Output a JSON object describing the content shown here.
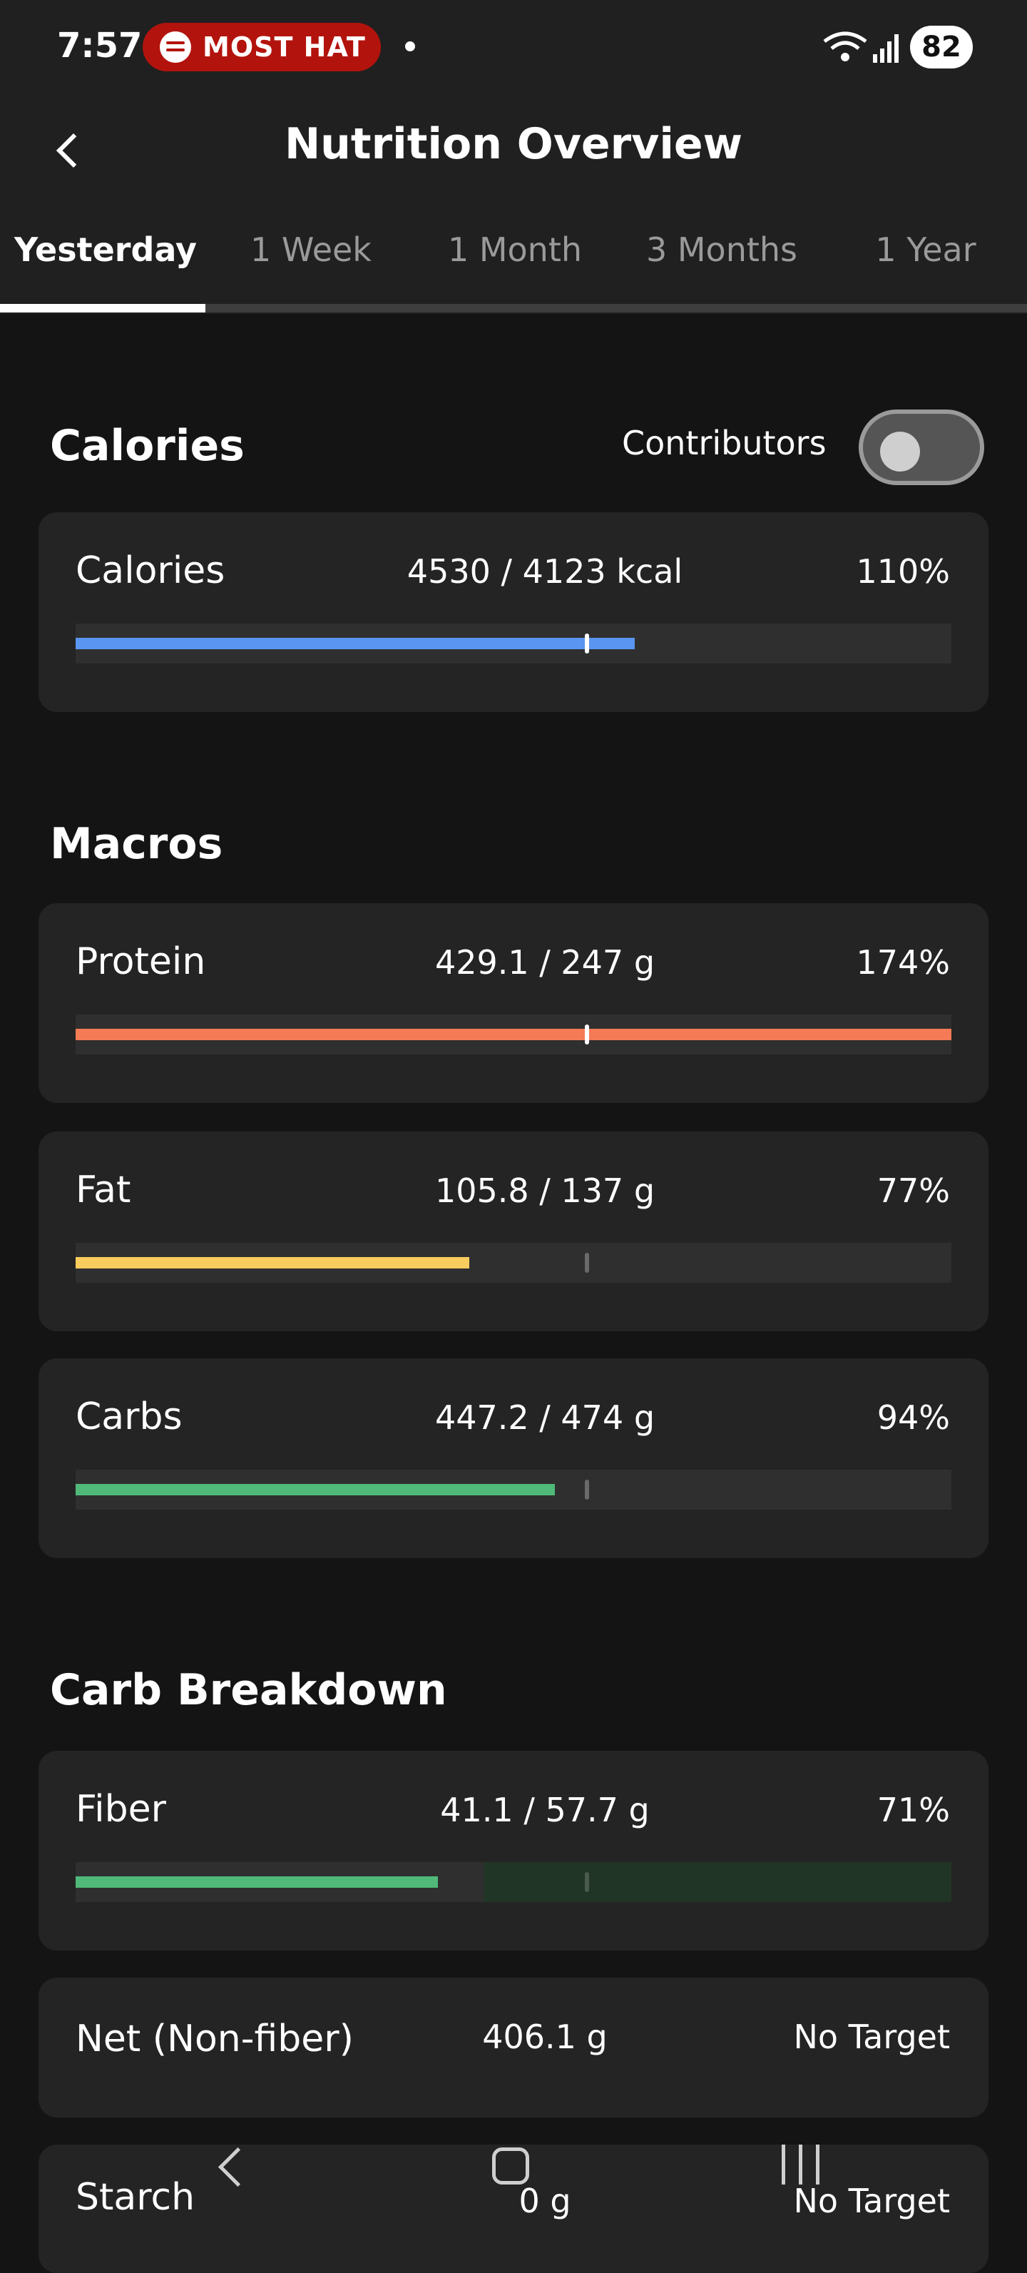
{
  "status_bar": {
    "time": "7:57",
    "media_pill_text": "MOST HAT",
    "battery": "82",
    "icons": [
      "spotify-icon",
      "wifi-icon",
      "signal-icon",
      "battery-icon"
    ]
  },
  "header": {
    "title": "Nutrition Overview",
    "back_icon": "chevron-left-icon"
  },
  "tabs": [
    {
      "label": "Yesterday",
      "active": true
    },
    {
      "label": "1 Week",
      "active": false
    },
    {
      "label": "1 Month",
      "active": false
    },
    {
      "label": "3 Months",
      "active": false
    },
    {
      "label": "1 Year",
      "active": false
    }
  ],
  "calories_section": {
    "title": "Calories",
    "contributors_label": "Contributors",
    "contributors_on": false,
    "card": {
      "name": "Calories",
      "amount": "4530 / 4123 kcal",
      "pct": "110%",
      "progress": 1.1,
      "color": "#5b95f2"
    }
  },
  "macros_section": {
    "title": "Macros",
    "items": [
      {
        "name": "Protein",
        "amount": "429.1 / 247 g",
        "pct": "174%",
        "progress": 1.74,
        "color": "#f47b56"
      },
      {
        "name": "Fat",
        "amount": "105.8 / 137 g",
        "pct": "77%",
        "progress": 0.77,
        "color": "#f9cd5d"
      },
      {
        "name": "Carbs",
        "amount": "447.2 / 474 g",
        "pct": "94%",
        "progress": 0.94,
        "color": "#50b97a"
      }
    ]
  },
  "carb_section": {
    "title": "Carb Breakdown",
    "fiber": {
      "name": "Fiber",
      "amount": "41.1 / 57.7 g",
      "pct": "71%",
      "progress": 0.71,
      "color": "#50b97a",
      "target_zone_color": "#213526"
    },
    "net": {
      "name": "Net (Non-fiber)",
      "amount": "406.1 g",
      "pct": "No Target"
    },
    "starch": {
      "name": "Starch",
      "amount": "0 g",
      "pct": "No Target"
    }
  },
  "nav_bar": {
    "icons": [
      "back-nav-icon",
      "home-nav-icon",
      "recent-apps-icon"
    ]
  }
}
